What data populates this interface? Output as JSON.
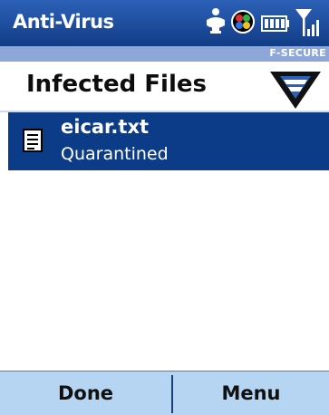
{
  "app": {
    "title": "Anti-Virus",
    "brand": "F-SECURE"
  },
  "status_icons": [
    "sync-icon",
    "color-circle-icon",
    "battery-icon",
    "signal-icon"
  ],
  "header": {
    "title": "Infected Files"
  },
  "list": {
    "items": [
      {
        "name": "eicar.txt",
        "status": "Quarantined",
        "icon": "text-file-icon"
      }
    ]
  },
  "softkeys": {
    "left": "Done",
    "right": "Menu"
  },
  "colors": {
    "titlebar": "#1b4b9b",
    "brand_strip": "#8fa6d9",
    "selection": "#0c3b87",
    "softkey_bg": "#b5d5f2"
  }
}
